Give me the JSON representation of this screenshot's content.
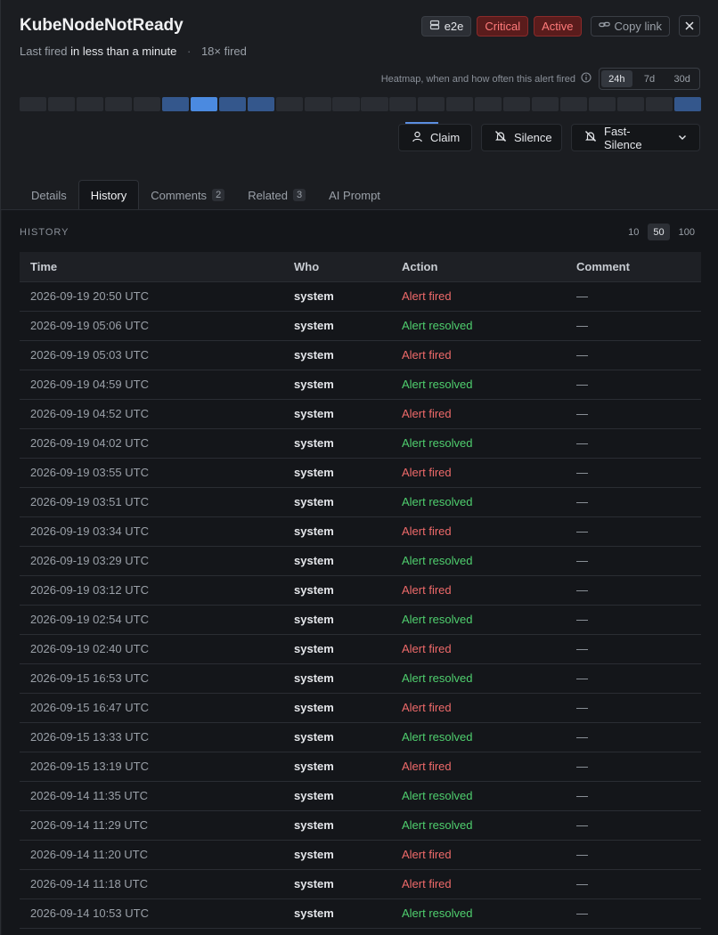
{
  "header": {
    "title": "KubeNodeNotReady",
    "last_fired_prefix": "Last fired",
    "last_fired_value": "in less than a minute",
    "separator": "·",
    "fired_count": "18× fired",
    "env_label": "e2e",
    "severity_label": "Critical",
    "status_label": "Active",
    "copy_link_label": "Copy link"
  },
  "heatmap": {
    "caption": "Heatmap, when and how often this alert fired",
    "ranges": [
      "24h",
      "7d",
      "30d"
    ],
    "selected_range": "24h",
    "levels": [
      0,
      0,
      0,
      0,
      0,
      2,
      3,
      2,
      2,
      0,
      0,
      0,
      0,
      0,
      0,
      0,
      0,
      0,
      0,
      0,
      0,
      0,
      0,
      2
    ],
    "level_colors": [
      "#2a2d33",
      "#3a5e95",
      "#34578c",
      "#4b8ae0"
    ]
  },
  "actions": {
    "claim_label": "Claim",
    "silence_label": "Silence",
    "fast_silence_label": "Fast-Silence"
  },
  "tabs": [
    {
      "label": "Details",
      "count": ""
    },
    {
      "label": "History",
      "count": ""
    },
    {
      "label": "Comments",
      "count": "2"
    },
    {
      "label": "Related",
      "count": "3"
    },
    {
      "label": "AI Prompt",
      "count": ""
    }
  ],
  "active_tab": "History",
  "history": {
    "section_label": "HISTORY",
    "page_sizes": [
      "10",
      "50",
      "100"
    ],
    "selected_page_size": "50",
    "columns": [
      "Time",
      "Who",
      "Action",
      "Comment"
    ],
    "rows": [
      {
        "time": "2026-09-19 20:50 UTC",
        "who": "system",
        "action": "Alert fired",
        "type": "fired",
        "comment": "—"
      },
      {
        "time": "2026-09-19 05:06 UTC",
        "who": "system",
        "action": "Alert resolved",
        "type": "resolved",
        "comment": "—"
      },
      {
        "time": "2026-09-19 05:03 UTC",
        "who": "system",
        "action": "Alert fired",
        "type": "fired",
        "comment": "—"
      },
      {
        "time": "2026-09-19 04:59 UTC",
        "who": "system",
        "action": "Alert resolved",
        "type": "resolved",
        "comment": "—"
      },
      {
        "time": "2026-09-19 04:52 UTC",
        "who": "system",
        "action": "Alert fired",
        "type": "fired",
        "comment": "—"
      },
      {
        "time": "2026-09-19 04:02 UTC",
        "who": "system",
        "action": "Alert resolved",
        "type": "resolved",
        "comment": "—"
      },
      {
        "time": "2026-09-19 03:55 UTC",
        "who": "system",
        "action": "Alert fired",
        "type": "fired",
        "comment": "—"
      },
      {
        "time": "2026-09-19 03:51 UTC",
        "who": "system",
        "action": "Alert resolved",
        "type": "resolved",
        "comment": "—"
      },
      {
        "time": "2026-09-19 03:34 UTC",
        "who": "system",
        "action": "Alert fired",
        "type": "fired",
        "comment": "—"
      },
      {
        "time": "2026-09-19 03:29 UTC",
        "who": "system",
        "action": "Alert resolved",
        "type": "resolved",
        "comment": "—"
      },
      {
        "time": "2026-09-19 03:12 UTC",
        "who": "system",
        "action": "Alert fired",
        "type": "fired",
        "comment": "—"
      },
      {
        "time": "2026-09-19 02:54 UTC",
        "who": "system",
        "action": "Alert resolved",
        "type": "resolved",
        "comment": "—"
      },
      {
        "time": "2026-09-19 02:40 UTC",
        "who": "system",
        "action": "Alert fired",
        "type": "fired",
        "comment": "—"
      },
      {
        "time": "2026-09-15 16:53 UTC",
        "who": "system",
        "action": "Alert resolved",
        "type": "resolved",
        "comment": "—"
      },
      {
        "time": "2026-09-15 16:47 UTC",
        "who": "system",
        "action": "Alert fired",
        "type": "fired",
        "comment": "—"
      },
      {
        "time": "2026-09-15 13:33 UTC",
        "who": "system",
        "action": "Alert resolved",
        "type": "resolved",
        "comment": "—"
      },
      {
        "time": "2026-09-15 13:19 UTC",
        "who": "system",
        "action": "Alert fired",
        "type": "fired",
        "comment": "—"
      },
      {
        "time": "2026-09-14 11:35 UTC",
        "who": "system",
        "action": "Alert resolved",
        "type": "resolved",
        "comment": "—"
      },
      {
        "time": "2026-09-14 11:29 UTC",
        "who": "system",
        "action": "Alert resolved",
        "type": "resolved",
        "comment": "—"
      },
      {
        "time": "2026-09-14 11:20 UTC",
        "who": "system",
        "action": "Alert fired",
        "type": "fired",
        "comment": "—"
      },
      {
        "time": "2026-09-14 11:18 UTC",
        "who": "system",
        "action": "Alert fired",
        "type": "fired",
        "comment": "—"
      },
      {
        "time": "2026-09-14 10:53 UTC",
        "who": "system",
        "action": "Alert resolved",
        "type": "resolved",
        "comment": "—"
      }
    ]
  },
  "icons": {
    "env": "server-icon",
    "copy": "link-icon",
    "close": "close-icon",
    "info": "info-icon",
    "claim": "user-icon",
    "silence": "bell-off-icon",
    "fast_silence": "bell-off-icon",
    "dropdown": "chevron-down-icon"
  }
}
